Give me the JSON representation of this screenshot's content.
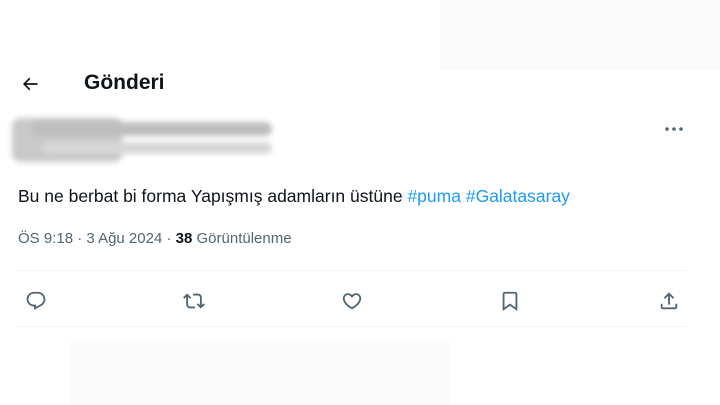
{
  "header": {
    "title": "Gönderi",
    "back_icon": "arrow-left-icon"
  },
  "post": {
    "text": "Bu ne berbat bi forma Yapışmış adamların üstüne",
    "hashtags": [
      "#puma",
      "#Galatasaray"
    ],
    "time": "ÖS 9:18",
    "separator": "·",
    "date": "3 Ağu 2024",
    "view_count": "38",
    "view_label": "Görüntülenme",
    "more_icon": "more-horizontal-icon"
  },
  "actions": [
    {
      "name": "reply",
      "icon": "reply-icon"
    },
    {
      "name": "repost",
      "icon": "repost-icon"
    },
    {
      "name": "like",
      "icon": "heart-icon"
    },
    {
      "name": "bookmark",
      "icon": "bookmark-icon"
    },
    {
      "name": "share",
      "icon": "share-icon"
    }
  ],
  "colors": {
    "text": "#0f1419",
    "secondary": "#536471",
    "link": "#1d9bf0",
    "divider": "#eff3f4"
  }
}
